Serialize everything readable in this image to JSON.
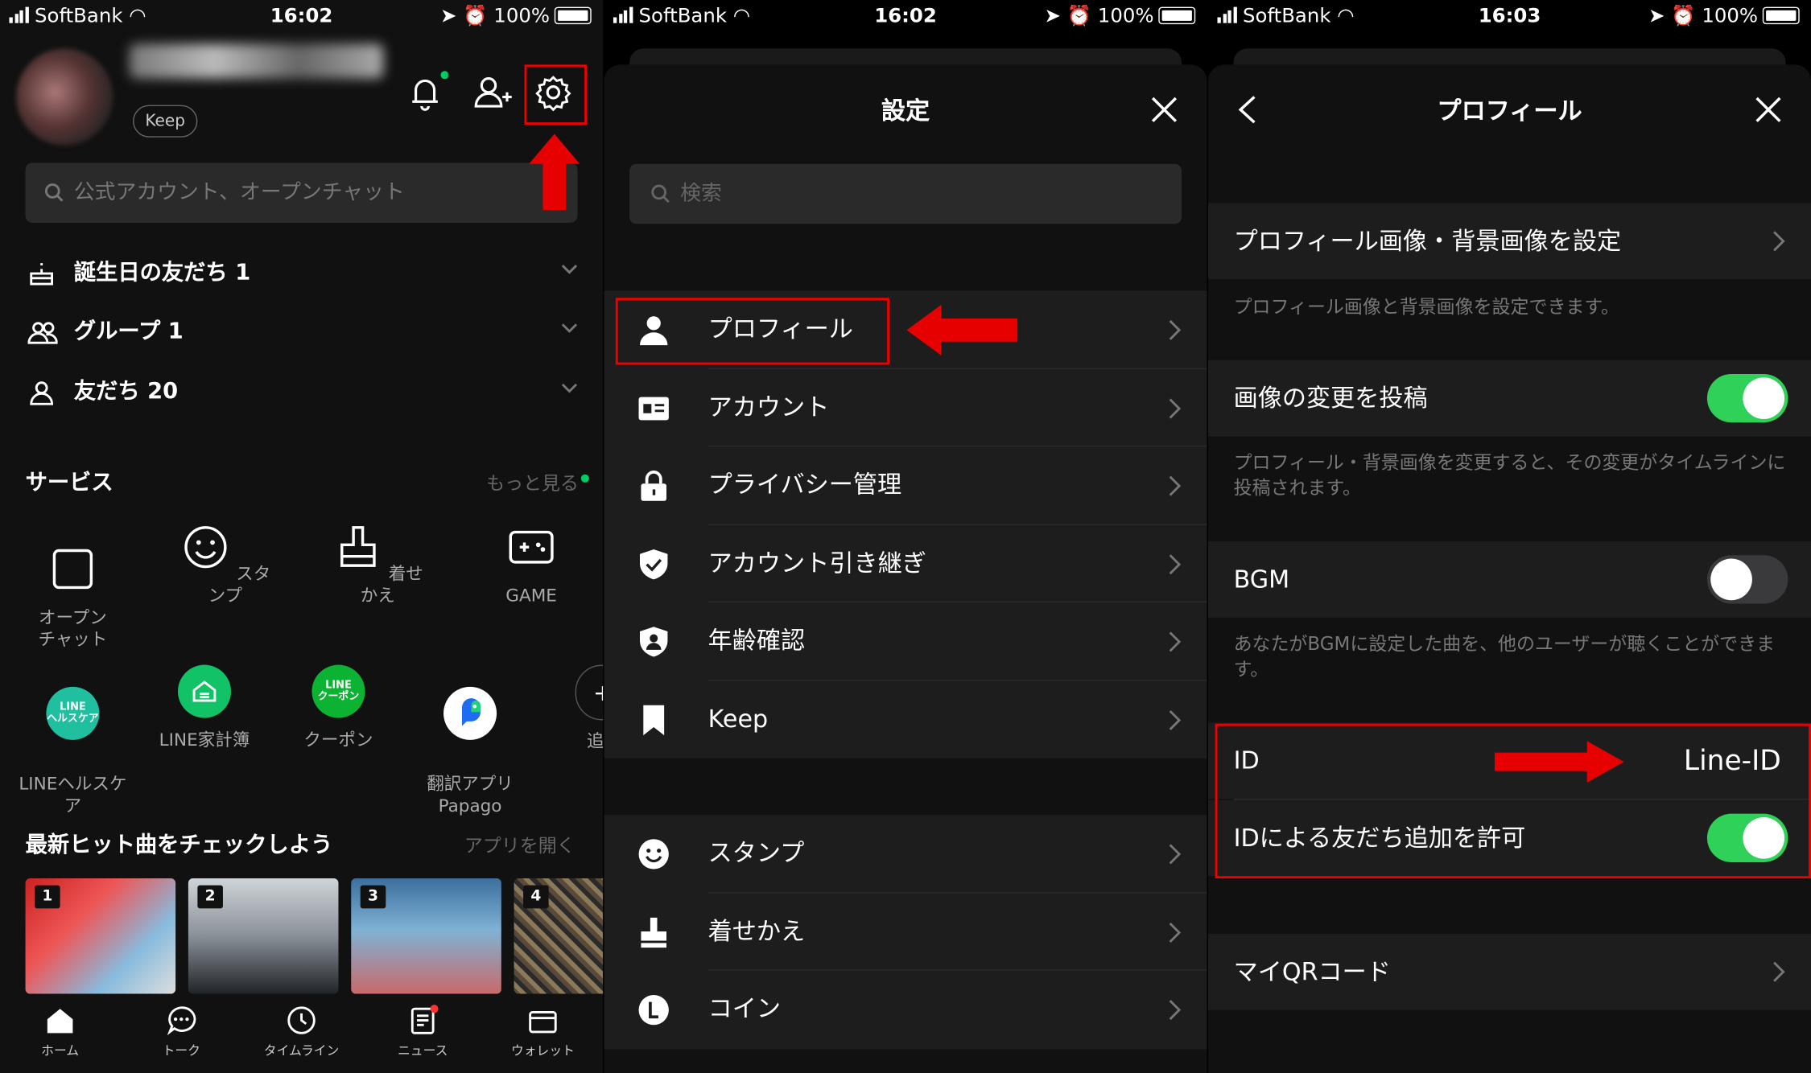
{
  "status_bars": [
    {
      "carrier": "SoftBank",
      "time": "16:02",
      "battery": "100%"
    },
    {
      "carrier": "SoftBank",
      "time": "16:02",
      "battery": "100%"
    },
    {
      "carrier": "SoftBank",
      "time": "16:03",
      "battery": "100%"
    }
  ],
  "home": {
    "keep_label": "Keep",
    "search_placeholder": "公式アカウント、オープンチャット",
    "friend_rows": [
      {
        "label": "誕生日の友だち 1",
        "icon": "cake-icon"
      },
      {
        "label": "グループ 1",
        "icon": "group-icon"
      },
      {
        "label": "友だち 20",
        "icon": "person-icon"
      }
    ],
    "services_title": "サービス",
    "services_more": "もっと見る",
    "services": [
      {
        "label": "オープン\nチャット",
        "icon": "open-chat-icon"
      },
      {
        "label": "スタンプ",
        "icon": "smile-icon"
      },
      {
        "label": "着せかえ",
        "icon": "brush-icon"
      },
      {
        "label": "GAME",
        "icon": "gamepad-icon"
      }
    ],
    "apps": [
      {
        "label": "LINEヘルスケ\nア",
        "badge": "LINE\nヘルスケア",
        "color": "#1fbfa0"
      },
      {
        "label": "LINE家計簿",
        "badge": "",
        "color": "#11c267"
      },
      {
        "label": "クーポン",
        "badge": "LINE\nクーポン",
        "color": "#0cb232"
      },
      {
        "label": "翻訳アプリ\nPapago",
        "badge": "",
        "color": "#ffffff"
      },
      {
        "label": "追",
        "badge": "+",
        "color": "#222222"
      }
    ],
    "hits_title": "最新ヒット曲をチェックしよう",
    "hits_open": "アプリを開く",
    "hits": [
      "1",
      "2",
      "3",
      "4"
    ],
    "tabs": [
      "ホーム",
      "トーク",
      "タイムライン",
      "ニュース",
      "ウォレット"
    ]
  },
  "settings": {
    "title": "設定",
    "search_placeholder": "検索",
    "group1": [
      {
        "label": "プロフィール",
        "icon": "person-icon"
      },
      {
        "label": "アカウント",
        "icon": "id-card-icon"
      },
      {
        "label": "プライバシー管理",
        "icon": "lock-icon"
      },
      {
        "label": "アカウント引き継ぎ",
        "icon": "shield-check-icon"
      },
      {
        "label": "年齢確認",
        "icon": "shield-person-icon"
      },
      {
        "label": "Keep",
        "icon": "bookmark-icon"
      }
    ],
    "group2": [
      {
        "label": "スタンプ",
        "icon": "smile-icon"
      },
      {
        "label": "着せかえ",
        "icon": "brush-icon"
      },
      {
        "label": "コイン",
        "icon": "coin-icon"
      }
    ]
  },
  "profile": {
    "title": "プロフィール",
    "row_image": "プロフィール画像・背景画像を設定",
    "desc_image": "プロフィール画像と背景画像を設定できます。",
    "row_post": "画像の変更を投稿",
    "post_on": true,
    "desc_post": "プロフィール・背景画像を変更すると、その変更がタイムラインに投稿されます。",
    "row_bgm": "BGM",
    "bgm_on": false,
    "desc_bgm": "あなたがBGMに設定した曲を、他のユーザーが聴くことができます。",
    "row_id": "ID",
    "id_value": "Line-ID",
    "row_allow": "IDによる友だち追加を許可",
    "allow_on": true,
    "row_qr": "マイQRコード"
  },
  "colors": {
    "accent_green": "#30d158",
    "annotation_red": "#e60000"
  }
}
